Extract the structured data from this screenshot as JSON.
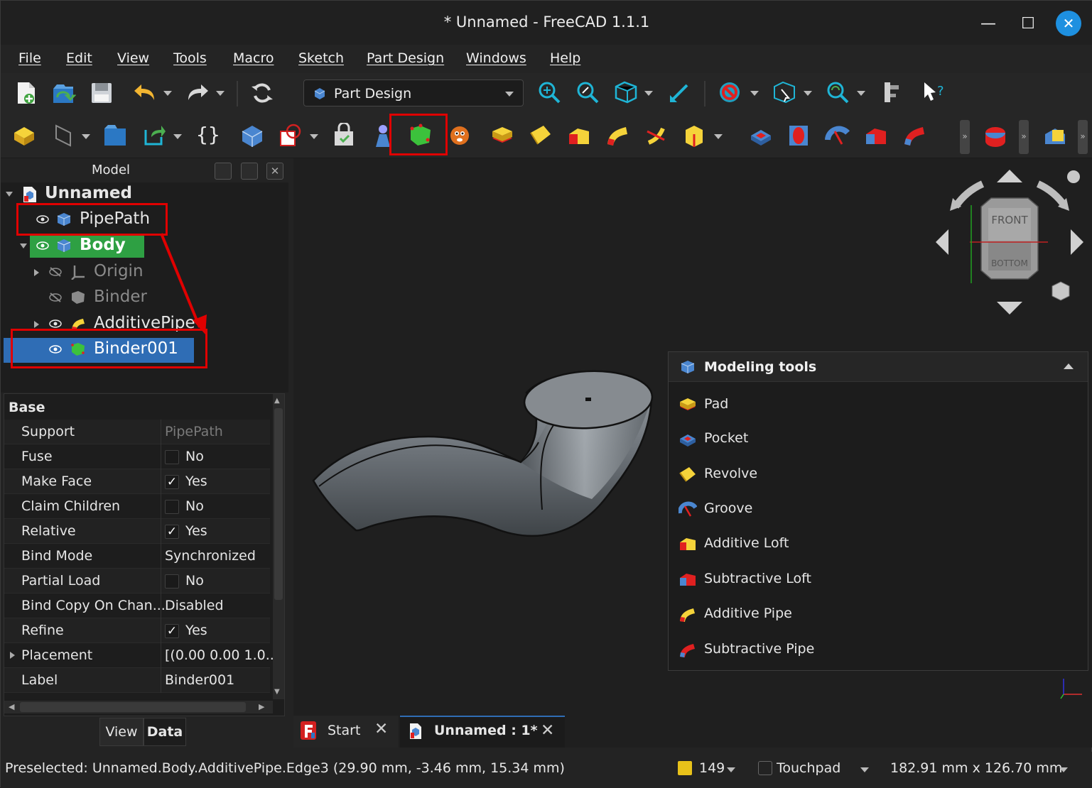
{
  "window": {
    "title": "* Unnamed - FreeCAD 1.1.1"
  },
  "menu": [
    "File",
    "Edit",
    "View",
    "Tools",
    "Macro",
    "Sketch",
    "Part Design",
    "Windows",
    "Help"
  ],
  "workbench": {
    "selected": "Part Design"
  },
  "model_panel": {
    "title": "Model",
    "tree": [
      {
        "label": "Unnamed",
        "level": 0,
        "bold": true
      },
      {
        "label": "PipePath",
        "level": 1
      },
      {
        "label": "Body",
        "level": 1,
        "bold": true,
        "active": true
      },
      {
        "label": "Origin",
        "level": 2,
        "hidden": true
      },
      {
        "label": "Binder",
        "level": 2,
        "hidden": true
      },
      {
        "label": "AdditivePipe",
        "level": 2
      },
      {
        "label": "Binder001",
        "level": 2,
        "selected": true
      }
    ]
  },
  "properties": {
    "group": "Base",
    "rows": [
      {
        "key": "Support",
        "value": "PipePath",
        "dim": true
      },
      {
        "key": "Fuse",
        "value": "No",
        "checkbox": true,
        "checked": false
      },
      {
        "key": "Make Face",
        "value": "Yes",
        "checkbox": true,
        "checked": true
      },
      {
        "key": "Claim Children",
        "value": "No",
        "checkbox": true,
        "checked": false
      },
      {
        "key": "Relative",
        "value": "Yes",
        "checkbox": true,
        "checked": true
      },
      {
        "key": "Bind Mode",
        "value": "Synchronized"
      },
      {
        "key": "Partial Load",
        "value": "No",
        "checkbox": true,
        "checked": false
      },
      {
        "key": "Bind Copy On Chan...",
        "value": "Disabled"
      },
      {
        "key": "Refine",
        "value": "Yes",
        "checkbox": true,
        "checked": true
      },
      {
        "key": "Placement",
        "value": "[(0.00 0.00 1.0...",
        "expandable": true
      },
      {
        "key": "Label",
        "value": "Binder001"
      }
    ],
    "tabs": [
      "View",
      "Data"
    ],
    "active_tab": "Data"
  },
  "modeling_tools": {
    "title": "Modeling tools",
    "items": [
      "Pad",
      "Pocket",
      "Revolve",
      "Groove",
      "Additive Loft",
      "Subtractive Loft",
      "Additive Pipe",
      "Subtractive Pipe"
    ]
  },
  "navcube": {
    "front": "FRONT",
    "bottom": "BOTTOM"
  },
  "doc_tabs": [
    {
      "label": "Start"
    },
    {
      "label": "Unnamed : 1*",
      "active": true
    }
  ],
  "status": {
    "message": "Preselected: Unnamed.Body.AdditivePipe.Edge3 (29.90 mm, -3.46 mm, 15.34 mm)",
    "count": "149",
    "nav_style": "Touchpad",
    "dimensions": "182.91 mm x 126.70 mm"
  },
  "colors": {
    "accent": "#1e90e0",
    "selection": "#2f6db5",
    "active_body": "#2ea043",
    "highlight": "#e00000"
  }
}
